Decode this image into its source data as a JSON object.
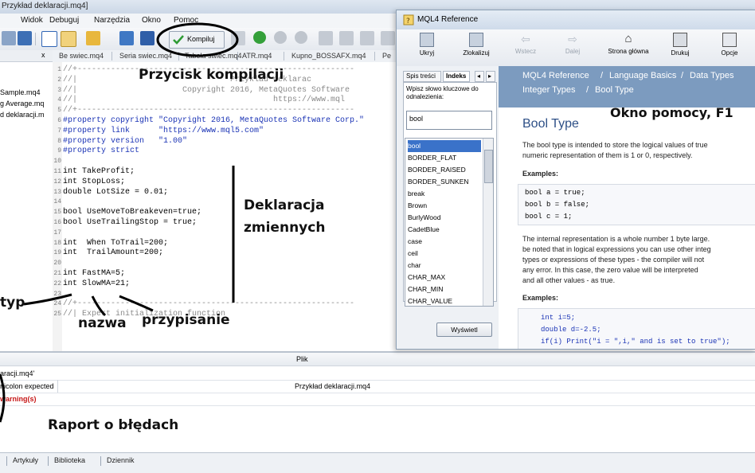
{
  "window": {
    "title": "Przykład deklaracji.mq4]"
  },
  "menu": [
    "Widok",
    "Debuguj",
    "Narzędzia",
    "Okno",
    "Pomoc"
  ],
  "toolbar": {
    "compile_label": "Kompiluj"
  },
  "navigator": {
    "tab_close": "x",
    "files": [
      "Sample.mq4",
      "g Average.mq",
      "d deklaracji.m"
    ]
  },
  "file_tabs": [
    "Be swiec.mq4",
    "Seria swiec.mq4",
    "Tabela swiec.mq4",
    "ATR.mq4",
    "Kupno_BOSSAFX.mq4",
    "Pe"
  ],
  "code_lines": [
    {
      "n": "1",
      "t": "//+----------------------------------------------------------"
    },
    {
      "n": "2",
      "t": "//|                                Przyklad deklarac"
    },
    {
      "n": "3",
      "t": "//|                      Copyright 2016, MetaQuotes Software"
    },
    {
      "n": "4",
      "t": "//|                                         https://www.mql"
    },
    {
      "n": "5",
      "t": "//+----------------------------------------------------------"
    },
    {
      "n": "6",
      "t": "#property copyright \"Copyright 2016, MetaQuotes Software Corp.\""
    },
    {
      "n": "7",
      "t": "#property link      \"https://www.mql5.com\""
    },
    {
      "n": "8",
      "t": "#property version   \"1.00\""
    },
    {
      "n": "9",
      "t": "#property strict"
    },
    {
      "n": "10",
      "t": ""
    },
    {
      "n": "11",
      "t": "int TakeProfit;"
    },
    {
      "n": "12",
      "t": "int StopLoss;"
    },
    {
      "n": "13",
      "t": "double LotSize = 0.01;"
    },
    {
      "n": "14",
      "t": ""
    },
    {
      "n": "15",
      "t": "bool UseMoveToBreakeven=true;"
    },
    {
      "n": "16",
      "t": "bool UseTrailingStop = true;"
    },
    {
      "n": "17",
      "t": ""
    },
    {
      "n": "18",
      "t": "int  When ToTrail=200;"
    },
    {
      "n": "19",
      "t": "int  TrailAmount=200;"
    },
    {
      "n": "20",
      "t": ""
    },
    {
      "n": "21",
      "t": "int FastMA=5;"
    },
    {
      "n": "22",
      "t": "int SlowMA=21;"
    },
    {
      "n": "23",
      "t": ""
    },
    {
      "n": "24",
      "t": "//+----------------------------------------------------------"
    },
    {
      "n": "25",
      "t": "//| Expert initialization function"
    }
  ],
  "bottom": {
    "header": "Plik",
    "rows": [
      {
        "left": "aracji.mq4'",
        "right": ""
      },
      {
        "left": "nicolon expected",
        "right": "Przykład deklaracji.mq4"
      },
      {
        "left": "warning(s)",
        "right": ""
      }
    ],
    "tabs": [
      "Artykuły",
      "Biblioteka",
      "Dziennik"
    ]
  },
  "help": {
    "title": "MQL4 Reference",
    "toolbar": [
      "Ukryj",
      "Zlokalizuj",
      "Wstecz",
      "Dalej",
      "Strona główna",
      "Drukuj",
      "Opcje"
    ],
    "tabs": [
      "Spis treści",
      "Indeks"
    ],
    "search_label": "Wpisz słowo kluczowe do odnalezienia:",
    "search_value": "bool",
    "index_items": [
      "bool",
      "BORDER_FLAT",
      "BORDER_RAISED",
      "BORDER_SUNKEN",
      "break",
      "Brown",
      "BurlyWood",
      "CadetBlue",
      "case",
      "ceil",
      "char",
      "CHAR_MAX",
      "CHAR_MIN",
      "CHAR_VALUE"
    ],
    "display_button": "Wyświetl",
    "breadcrumb": [
      "MQL4 Reference",
      "Language Basics",
      "Data Types",
      "Integer Types",
      "Bool Type"
    ],
    "page_title": "Bool Type",
    "para1": [
      "The bool type is intended to store the logical values of true",
      "numeric representation of them is 1 or 0, respectively."
    ],
    "examples_label": "Examples:",
    "code1": [
      "bool a = true;",
      "bool b = false;",
      "bool c = 1;"
    ],
    "para2": [
      "The internal representation is a whole number 1 byte large.",
      "be noted that in logical expressions you can use other integ",
      "types or expressions of these types - the compiler will not",
      "any error. In this case, the zero value will be interpreted",
      "and all other values - as true."
    ],
    "code2": [
      "int i=5;",
      "double d=-2.5;",
      "if(i) Print(\"i = \",i,\" and is set to true\");"
    ]
  },
  "annotations": {
    "compile": "Przycisk kompilacji",
    "help": "Okno pomocy, F1",
    "declaration": [
      "Deklaracja",
      "zmiennych"
    ],
    "type": "typ",
    "name": "nazwa",
    "assign": "przypisanie",
    "errors": "Raport o błędach"
  }
}
